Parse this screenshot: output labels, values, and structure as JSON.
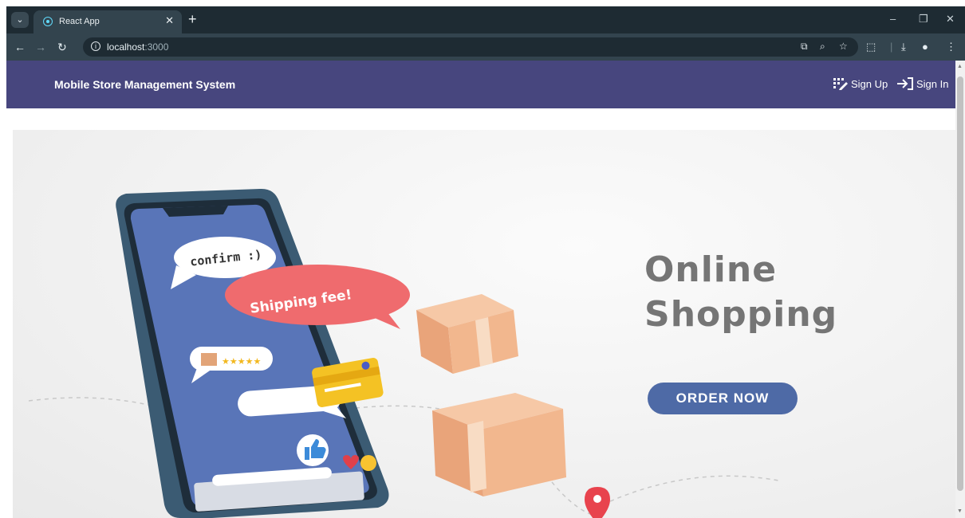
{
  "browser": {
    "tab_title": "React App",
    "url_host": "localhost",
    "url_port": ":3000"
  },
  "navbar": {
    "brand": "Mobile Store Management System",
    "signup_label": "Sign Up",
    "signin_label": "Sign In",
    "color": "#47467e"
  },
  "hero": {
    "title_line1": "Online",
    "title_line2": "Shopping",
    "cta_label": "ORDER NOW",
    "bubble_confirm": "confirm :)",
    "bubble_shipping": "Shipping fee!",
    "accent": "#4e6aa6"
  }
}
